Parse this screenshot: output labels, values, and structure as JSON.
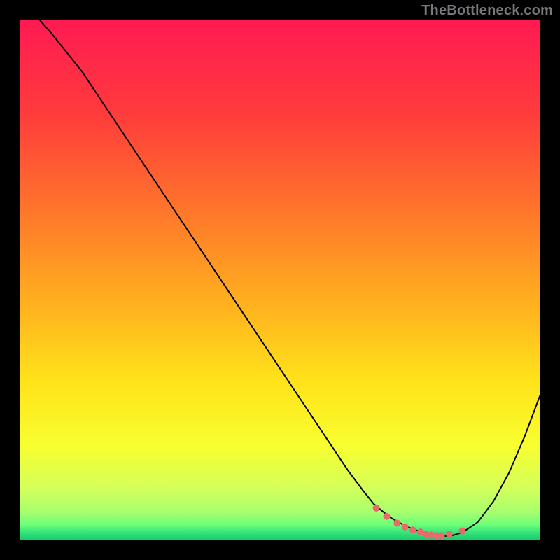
{
  "watermark": "TheBottleneck.com",
  "chart_data": {
    "type": "line",
    "title": "",
    "xlabel": "",
    "ylabel": "",
    "xlim": [
      0,
      100
    ],
    "ylim": [
      0,
      100
    ],
    "grid": false,
    "legend": false,
    "series": [
      {
        "name": "curve",
        "x": [
          3.8,
          6,
          12,
          18,
          24,
          30,
          36,
          42,
          48,
          54,
          60,
          63,
          66,
          68,
          71,
          74,
          77,
          79,
          81,
          83,
          85,
          88,
          91,
          94,
          97,
          100
        ],
        "y": [
          100,
          97.5,
          90,
          81,
          72,
          63,
          54,
          45,
          36,
          27,
          18,
          13.5,
          9.5,
          7,
          4.5,
          2.8,
          1.6,
          1.0,
          0.8,
          0.9,
          1.5,
          3.5,
          7.5,
          13,
          20,
          28
        ],
        "stroke": "#000000",
        "stroke_width": 2
      }
    ],
    "markers": {
      "name": "bottom-dots",
      "x": [
        68.5,
        70.5,
        72.5,
        74.0,
        75.5,
        77.0,
        78.0,
        79.0,
        80.0,
        81.0,
        82.5,
        85.0
      ],
      "y": [
        6.2,
        4.6,
        3.3,
        2.6,
        2.0,
        1.6,
        1.2,
        1.0,
        0.9,
        0.9,
        1.2,
        1.8
      ],
      "color": "#e86a6a",
      "radius": 5
    },
    "background_gradient": {
      "stops": [
        {
          "offset": 0.0,
          "color": "#ff1a52"
        },
        {
          "offset": 0.18,
          "color": "#ff3b3c"
        },
        {
          "offset": 0.38,
          "color": "#ff7a2a"
        },
        {
          "offset": 0.55,
          "color": "#ffb21e"
        },
        {
          "offset": 0.7,
          "color": "#ffe41a"
        },
        {
          "offset": 0.82,
          "color": "#f8ff30"
        },
        {
          "offset": 0.9,
          "color": "#d4ff5a"
        },
        {
          "offset": 0.945,
          "color": "#a8ff6e"
        },
        {
          "offset": 0.97,
          "color": "#6dff78"
        },
        {
          "offset": 0.985,
          "color": "#34e47a"
        },
        {
          "offset": 1.0,
          "color": "#18c96a"
        }
      ]
    }
  }
}
